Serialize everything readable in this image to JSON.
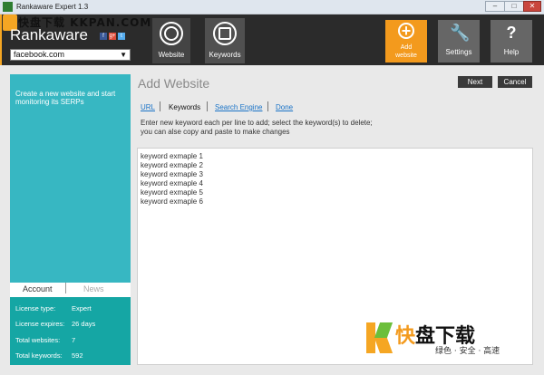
{
  "window": {
    "title": "Rankaware Expert 1.3",
    "min_glyph": "–",
    "max_glyph": "□",
    "close_glyph": "✕"
  },
  "watermark": {
    "top_text": "快盘下载 KKPAN.COM",
    "bottom_name_a": "快",
    "bottom_name_b": "盘下载",
    "bottom_slogan": "绿色 · 安全 · 高速"
  },
  "header": {
    "brand": "Rankaware",
    "social": [
      {
        "icon": "facebook-icon",
        "glyph": "f",
        "color": "#3b5998"
      },
      {
        "icon": "google-plus-icon",
        "glyph": "g+",
        "color": "#dd4b39"
      },
      {
        "icon": "twitter-icon",
        "glyph": "t",
        "color": "#55acee"
      }
    ],
    "site_select": {
      "value": "facebook.com"
    },
    "nav": {
      "website": "Website",
      "keywords": "Keywords",
      "add_line1": "Add",
      "add_line2": "website",
      "settings": "Settings",
      "help": "Help",
      "help_glyph": "?",
      "settings_glyph": "🔧"
    },
    "colors": {
      "accent": "#f39a1d",
      "dark": "#2b2b2b"
    }
  },
  "sidebar": {
    "info": "Create a new website and start monitoring its SERPs",
    "tabs": {
      "account": "Account",
      "news": "News"
    },
    "license": [
      {
        "key": "License type:",
        "value": "Expert"
      },
      {
        "key": "License expires:",
        "value": "26 days"
      },
      {
        "key": "Total websites:",
        "value": "7"
      },
      {
        "key": "Total keywords:",
        "value": "592"
      }
    ],
    "colors": {
      "info_bg": "#37b7c2",
      "license_bg": "#15a6a4"
    }
  },
  "main": {
    "title": "Add Website",
    "next": "Next",
    "cancel": "Cancel",
    "steps": [
      "URL",
      "Keywords",
      "Search Engine",
      "Done"
    ],
    "active_step": "Keywords",
    "hint": "Enter new keyword each per line to add; select the keyword(s) to delete; you can alse copy and paste to make changes",
    "keywords": [
      "keyword exmaple 1",
      "keyword exmaple 2",
      "keyword exmaple 3",
      "keyword exmaple 4",
      "keyword exmaple 5",
      "keyword exmaple 6"
    ]
  }
}
